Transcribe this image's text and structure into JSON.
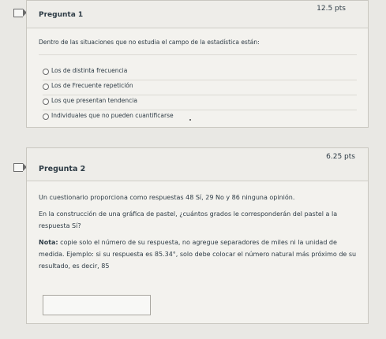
{
  "questions": [
    {
      "title": "Pregunta 1",
      "points": "12.5 pts",
      "prompt": "Dentro de las situaciones que no estudia el campo de la estadística están:",
      "answers": [
        "Los de distinta frecuencia",
        "Los de Frecuente repetición",
        "Los que presentan tendencia",
        "Individuales que no pueden cuantificarse"
      ]
    },
    {
      "title": "Pregunta 2",
      "points": "6.25 pts",
      "paragraph1": "Un cuestionario proporciona como respuestas 48 Sí, 29 No y 86 ninguna opinión.",
      "paragraph2": "En la construcción de una gráfica de pastel, ¿cuántos grados le corresponderán del pastel a la respuesta Sí?",
      "note_label": "Nota:",
      "note_text": " copie solo el número de su respuesta, no agregue separadores de miles ni la unidad de medida. Ejemplo: si su respuesta es 85.34°, solo debe colocar el número natural más próximo de su resultado, es decir, 85",
      "answer_value": ""
    }
  ]
}
